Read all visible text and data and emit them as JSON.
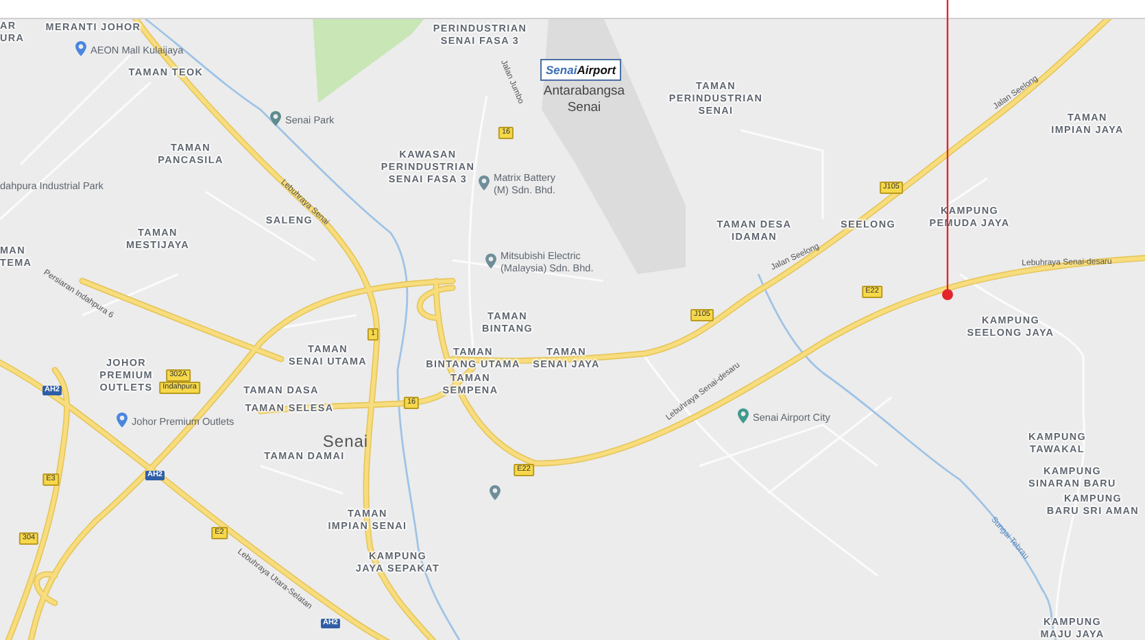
{
  "map": {
    "areas": [
      {
        "lines": [
          "AR",
          "URA"
        ]
      },
      {
        "lines": [
          "MERANTI JOHOR"
        ]
      },
      {
        "lines": [
          "TAMAN TEOK"
        ]
      },
      {
        "lines": [
          "TAMAN",
          "PANCASILA"
        ]
      },
      {
        "lines": [
          "SALENG"
        ]
      },
      {
        "lines": [
          "TAMAN",
          "MESTIJAYA"
        ]
      },
      {
        "lines": [
          "MAN",
          "TEMA"
        ]
      },
      {
        "lines": [
          "PERINDUSTRIAN",
          "SENAI FASA 3"
        ]
      },
      {
        "lines": [
          "KAWASAN",
          "PERINDUSTRIAN",
          "SENAI FASA 3"
        ]
      },
      {
        "lines": [
          "TAMAN",
          "PERINDUSTRIAN",
          "SENAI"
        ]
      },
      {
        "lines": [
          "TAMAN DESA",
          "IDAMAN"
        ]
      },
      {
        "lines": [
          "SEELONG"
        ]
      },
      {
        "lines": [
          "TAMAN",
          "IMPIAN JAYA"
        ]
      },
      {
        "lines": [
          "KAMPUNG",
          "PEMUDA JAYA"
        ]
      },
      {
        "lines": [
          "TAMAN",
          "BINTANG"
        ]
      },
      {
        "lines": [
          "KAMPUNG",
          "SEELONG JAYA"
        ]
      },
      {
        "lines": [
          "TAMAN",
          "BINTANG UTAMA"
        ]
      },
      {
        "lines": [
          "TAMAN",
          "SENAI JAYA"
        ]
      },
      {
        "lines": [
          "TAMAN",
          "SEMPENA"
        ]
      },
      {
        "lines": [
          "TAMAN",
          "SENAI UTAMA"
        ]
      },
      {
        "lines": [
          "TAMAN DASA"
        ]
      },
      {
        "lines": [
          "TAMAN SELESA"
        ]
      },
      {
        "lines": [
          "TAMAN DAMAI"
        ]
      },
      {
        "lines": [
          "JOHOR",
          "PREMIUM",
          "OUTLETS"
        ]
      },
      {
        "lines": [
          "TAMAN",
          "IMPIAN SENAI"
        ]
      },
      {
        "lines": [
          "KAMPUNG",
          "JAYA SEPAKAT"
        ]
      },
      {
        "lines": [
          "KAMPUNG",
          "TAWAKAL"
        ]
      },
      {
        "lines": [
          "KAMPUNG",
          "SINARAN BARU"
        ]
      },
      {
        "lines": [
          "KAMPUNG",
          "BARU SRI AMAN"
        ]
      },
      {
        "lines": [
          "KAMPUNG",
          "MAJU JAYA"
        ]
      }
    ],
    "town": "Senai",
    "airport": {
      "logo": "Senai**Airport**",
      "name": [
        "Antarabangsa",
        "Senai"
      ]
    },
    "places": [
      {
        "lines": [
          "AEON Mall Kulaijaya"
        ],
        "color": "#4a86e0"
      },
      {
        "lines": [
          "Senai Park"
        ],
        "color": "#5e8c8f"
      },
      {
        "lines": [
          "Matrix Battery",
          "(M) Sdn. Bhd."
        ],
        "color": "#6f8e9a"
      },
      {
        "lines": [
          "Mitsubishi Electric",
          "(Malaysia) Sdn. Bhd."
        ],
        "color": "#6f8e9a"
      },
      {
        "lines": [
          "Johor Premium Outlets"
        ],
        "color": "#4a86e0"
      },
      {
        "lines": [
          "Senai Airport City"
        ],
        "color": "#3f9a8e"
      }
    ],
    "pins": [
      {
        "color": "#6f8e9a"
      }
    ],
    "text_labels": [
      "dahpura Industrial Park"
    ],
    "roads": [
      {
        "text": "Lebuhraya Senai",
        "kind": "road"
      },
      {
        "text": "Jalan Seelong",
        "kind": "road"
      },
      {
        "text": "Jalan Seelong",
        "kind": "road"
      },
      {
        "text": "Lebuhraya Senai-desaru",
        "kind": "road"
      },
      {
        "text": "Lebuhraya Senai-desaru",
        "kind": "road"
      },
      {
        "text": "Lebuhraya Utara-Selatan",
        "kind": "road"
      },
      {
        "text": "Persiaran Indahpura 6",
        "kind": "road"
      },
      {
        "text": "Jalan Jumbo",
        "kind": "road"
      },
      {
        "text": "Sungai Tebrau",
        "kind": "river"
      }
    ],
    "shields": [
      {
        "text": "16",
        "kind": "state"
      },
      {
        "text": "J105",
        "kind": "state"
      },
      {
        "text": "J105",
        "kind": "state"
      },
      {
        "text": "E22",
        "kind": "state"
      },
      {
        "text": "1",
        "kind": "state"
      },
      {
        "text": "302A",
        "kind": "state"
      },
      {
        "text": "Indahpura",
        "kind": "state"
      },
      {
        "text": "16",
        "kind": "state"
      },
      {
        "text": "E22",
        "kind": "state"
      },
      {
        "text": "E3",
        "kind": "state"
      },
      {
        "text": "304",
        "kind": "state"
      },
      {
        "text": "E2",
        "kind": "state"
      },
      {
        "text": "AH2",
        "kind": "asian"
      },
      {
        "text": "AH2",
        "kind": "asian"
      },
      {
        "text": "AH2",
        "kind": "asian"
      }
    ]
  }
}
